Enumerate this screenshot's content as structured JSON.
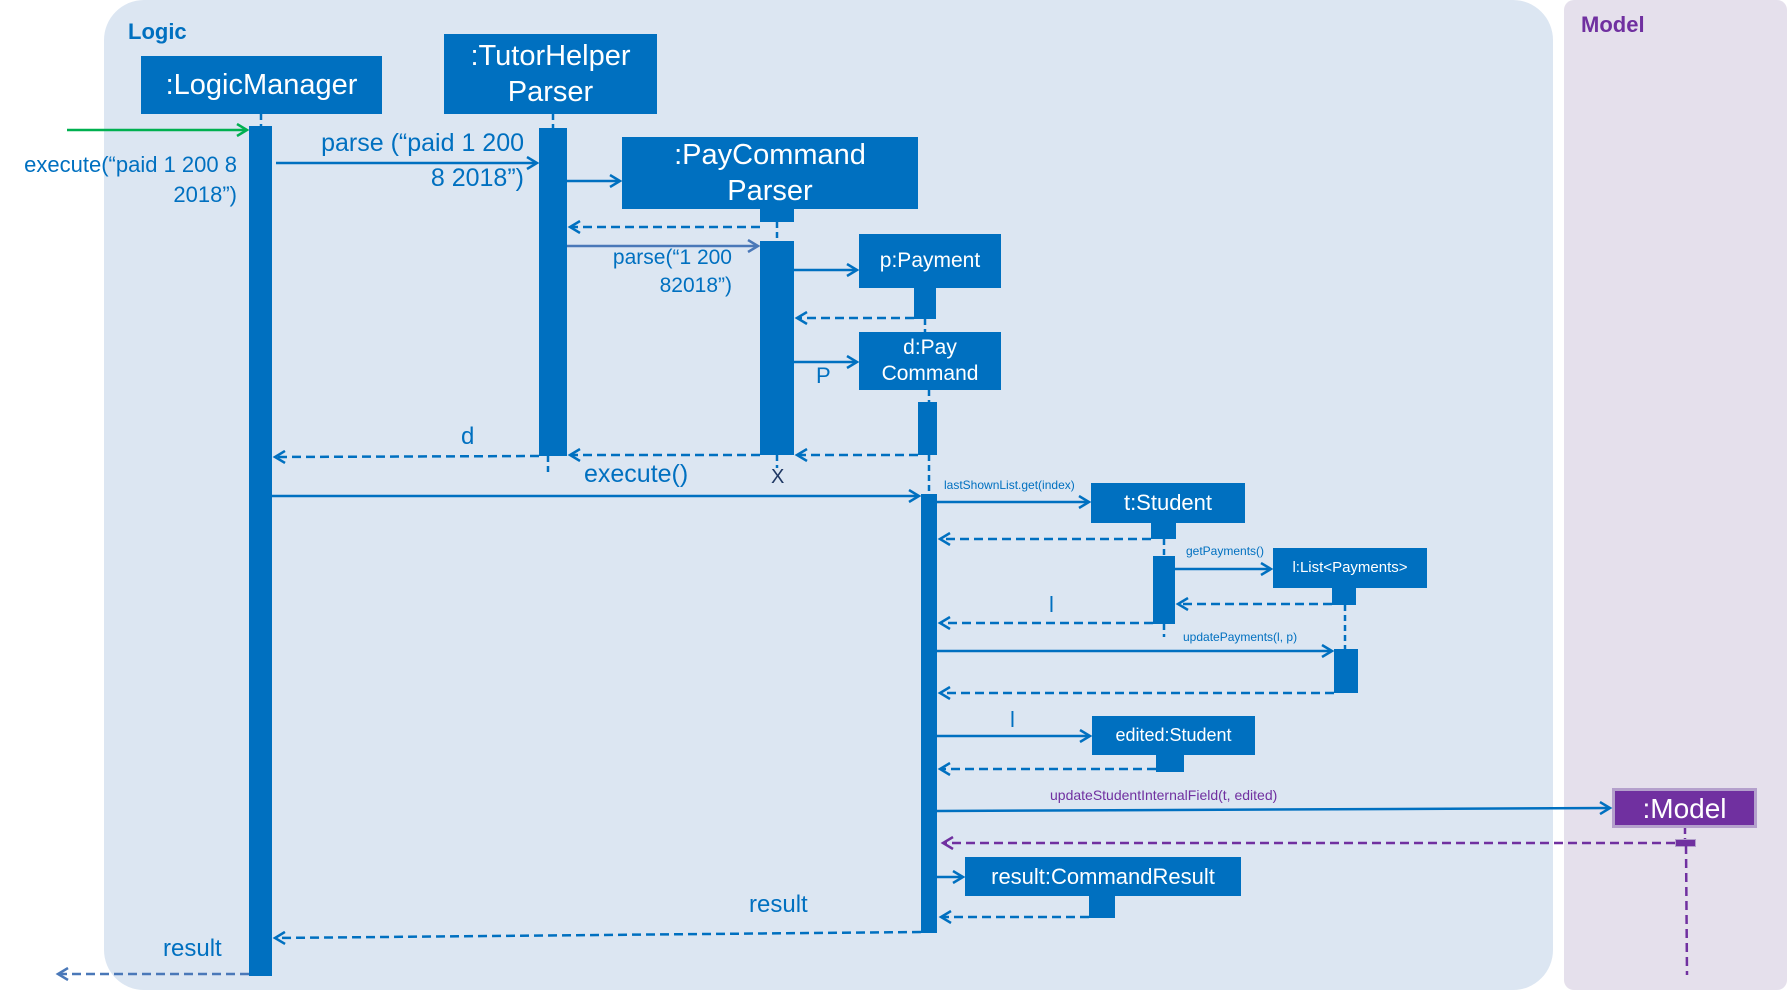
{
  "panels": {
    "logic": {
      "title": "Logic",
      "color": "#0070c0",
      "background": "#dce6f2"
    },
    "model": {
      "title": "Model",
      "color": "#7030a0",
      "background": "#e5e0ec"
    }
  },
  "participants": {
    "logic_manager": ":LogicManager",
    "tutor_helper_parser": [
      ":TutorHelper",
      "Parser"
    ],
    "pay_command_parser": [
      ":PayCommand",
      "Parser"
    ],
    "payment": "p:Payment",
    "pay_command": [
      "d:Pay",
      "Command"
    ],
    "student": "t:Student",
    "payment_list": "l:List<Payments>",
    "edited_student": "edited:Student",
    "model": ":Model",
    "command_result": "result:CommandResult"
  },
  "messages": {
    "execute_call": [
      "execute(“paid 1 200 8",
      "2018”)"
    ],
    "parse_call": [
      "parse (“paid 1 200",
      "8 2018”)"
    ],
    "parse_args": [
      "parse(“1 200",
      "82018”)"
    ],
    "p_arg": "P",
    "d_return": "d",
    "execute": "execute()",
    "destroy_mark": "X",
    "last_shown": "lastShownList.get(index)",
    "get_payments": "getPayments()",
    "l_return": "l",
    "update_payments": "updatePayments(l, p)",
    "l_arg": "l",
    "update_student": "updateStudentInternalField(t, edited)",
    "result_inner": "result",
    "result_outer": "result"
  },
  "colors": {
    "primary": "#0070c0",
    "model": "#7030a0",
    "entry_arrow": "#00b050"
  }
}
